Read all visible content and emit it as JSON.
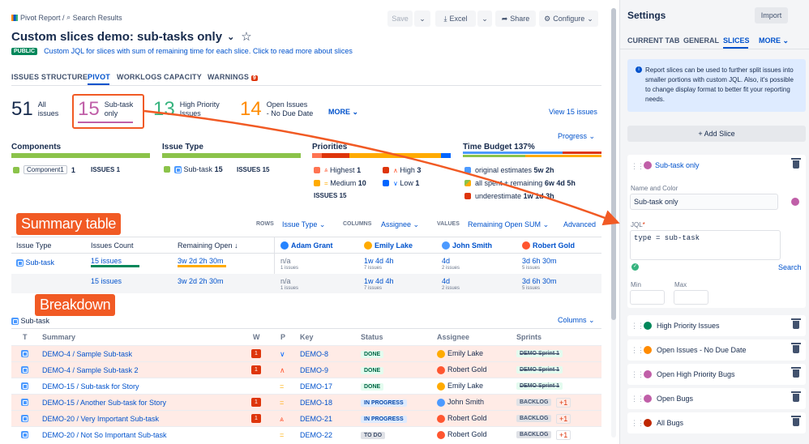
{
  "breadcrumb": {
    "root": "Pivot Report",
    "sep": "/",
    "search": "Search Results"
  },
  "toolbar": {
    "save": "Save",
    "excel": "Excel",
    "share": "Share",
    "configure": "Configure"
  },
  "title": "Custom slices demo: sub-tasks only",
  "badge": "PUBLIC",
  "description": "Custom JQL for slices with sum of remaining time for each slice. Click to read more about slices",
  "tabs": [
    "ISSUES STRUCTURE",
    "PIVOT",
    "WORKLOGS",
    "CAPACITY",
    "WARNINGS"
  ],
  "warnings_count": "9",
  "stats": [
    {
      "num": "51",
      "label1": "All",
      "label2": "issues",
      "color": "#172b4d"
    },
    {
      "num": "15",
      "label1": "Sub-task",
      "label2": "only",
      "color": "#c05fa8"
    },
    {
      "num": "13",
      "label1": "High Priority",
      "label2": "Issues",
      "color": "#36b37e"
    },
    {
      "num": "14",
      "label1": "Open Issues",
      "label2": "- No Due Date",
      "color": "#ff8b00"
    }
  ],
  "more": "MORE",
  "view_issues": "View 15 issues",
  "progress": "Progress",
  "groups": {
    "components": {
      "title": "Components",
      "item": "Component1",
      "item_count": "1",
      "issues": "ISSUES 1"
    },
    "issue_type": {
      "title": "Issue Type",
      "item": "Sub-task",
      "item_count": "15",
      "issues": "ISSUES 15"
    },
    "priorities": {
      "title": "Priorities",
      "highest": "Highest",
      "highest_n": "1",
      "high": "High",
      "high_n": "3",
      "medium": "Medium",
      "medium_n": "10",
      "low": "Low",
      "low_n": "1",
      "issues": "ISSUES 15"
    },
    "time_budget": {
      "title": "Time Budget",
      "pct": "137%",
      "orig": "original estimates",
      "orig_v": "5w 2h",
      "spent": "all spent + remaining",
      "spent_v": "6w 4d 5h",
      "under": "underestimate",
      "under_v": "1w 1d 3h"
    }
  },
  "callouts": {
    "summary": "Summary table",
    "breakdown": "Breakdown"
  },
  "pivot_controls": {
    "rows": "ROWS",
    "rows_v": "Issue Type",
    "columns": "COLUMNS",
    "columns_v": "Assignee",
    "values": "VALUES",
    "values_v": "Remaining Open SUM",
    "advanced": "Advanced"
  },
  "summary": {
    "headers": [
      "Issue Type",
      "Issues Count",
      "Remaining Open",
      "Adam Grant",
      "Emily Lake",
      "John Smith",
      "Robert Gold"
    ],
    "rows": [
      {
        "type": "Sub-task",
        "count": "15 issues",
        "remaining": "3w 2d 2h 30m",
        "c1": "n/a",
        "c1s": "1 issues",
        "c2": "1w 4d 4h",
        "c2s": "7 issues",
        "c3": "4d",
        "c3s": "2 issues",
        "c4": "3d 6h 30m",
        "c4s": "5 issues"
      },
      {
        "type": "",
        "count": "15 issues",
        "remaining": "3w 2d 2h 30m",
        "c1": "n/a",
        "c1s": "1 issues",
        "c2": "1w 4d 4h",
        "c2s": "7 issues",
        "c3": "4d",
        "c3s": "2 issues",
        "c4": "3d 6h 30m",
        "c4s": "5 issues"
      }
    ]
  },
  "breakdown": {
    "group": "Sub-task",
    "columns_btn": "Columns",
    "headers": [
      "T",
      "Summary",
      "W",
      "P",
      "Key",
      "Status",
      "Assignee",
      "Sprints"
    ],
    "rows": [
      {
        "summary": "DEMO-4 /  Sample Sub-task",
        "w": "1",
        "p": "low",
        "key": "DEMO-8",
        "status": "DONE",
        "st": "done",
        "assignee": "Emily Lake",
        "sprint": "DEMO Sprint 1",
        "extra": "",
        "hl": true
      },
      {
        "summary": "DEMO-4 /  Sample Sub-task 2",
        "w": "1",
        "p": "high",
        "key": "DEMO-9",
        "status": "DONE",
        "st": "done",
        "assignee": "Robert Gold",
        "sprint": "DEMO Sprint 1",
        "extra": "",
        "hl": true
      },
      {
        "summary": "DEMO-15 /  Sub-task for Story",
        "w": "",
        "p": "medium",
        "key": "DEMO-17",
        "status": "DONE",
        "st": "done",
        "assignee": "Emily Lake",
        "sprint": "DEMO Sprint 1",
        "extra": "",
        "hl": false
      },
      {
        "summary": "DEMO-15 /  Another Sub-task for Story",
        "w": "1",
        "p": "medium",
        "key": "DEMO-18",
        "status": "IN PROGRESS",
        "st": "prog",
        "assignee": "John Smith",
        "sprint": "BACKLOG",
        "extra": "+1",
        "hl": true
      },
      {
        "summary": "DEMO-20 /  Very Important Sub-task",
        "w": "1",
        "p": "highest",
        "key": "DEMO-21",
        "status": "IN PROGRESS",
        "st": "prog",
        "assignee": "Robert Gold",
        "sprint": "BACKLOG",
        "extra": "+1",
        "hl": true
      },
      {
        "summary": "DEMO-20 /  Not So Important Sub-task",
        "w": "",
        "p": "medium",
        "key": "DEMO-22",
        "status": "TO DO",
        "st": "todo",
        "assignee": "Robert Gold",
        "sprint": "BACKLOG",
        "extra": "+1",
        "hl": false
      }
    ]
  },
  "settings": {
    "title": "Settings",
    "import": "Import",
    "tabs": [
      "CURRENT TAB",
      "GENERAL",
      "SLICES",
      "MORE"
    ],
    "info": "Report slices can be used to further split issues into smaller portions with custom JQL. Also, it's possible to change display format to better fit your reporting needs.",
    "add_slice": "+ Add Slice",
    "active_slice": "Sub-task only",
    "name_color_label": "Name and Color",
    "name_value": "Sub-task only",
    "jql_label": "JQL",
    "jql_value": "type = sub-task",
    "search": "Search",
    "min": "Min",
    "max": "Max",
    "slices": [
      {
        "name": "High Priority Issues",
        "color": "#00875a"
      },
      {
        "name": "Open Issues - No Due Date",
        "color": "#ff8b00"
      },
      {
        "name": "Open High Priority Bugs",
        "color": "#c05fa8"
      },
      {
        "name": "Open Bugs",
        "color": "#c05fa8"
      },
      {
        "name": "All Bugs",
        "color": "#bf2600"
      }
    ]
  }
}
